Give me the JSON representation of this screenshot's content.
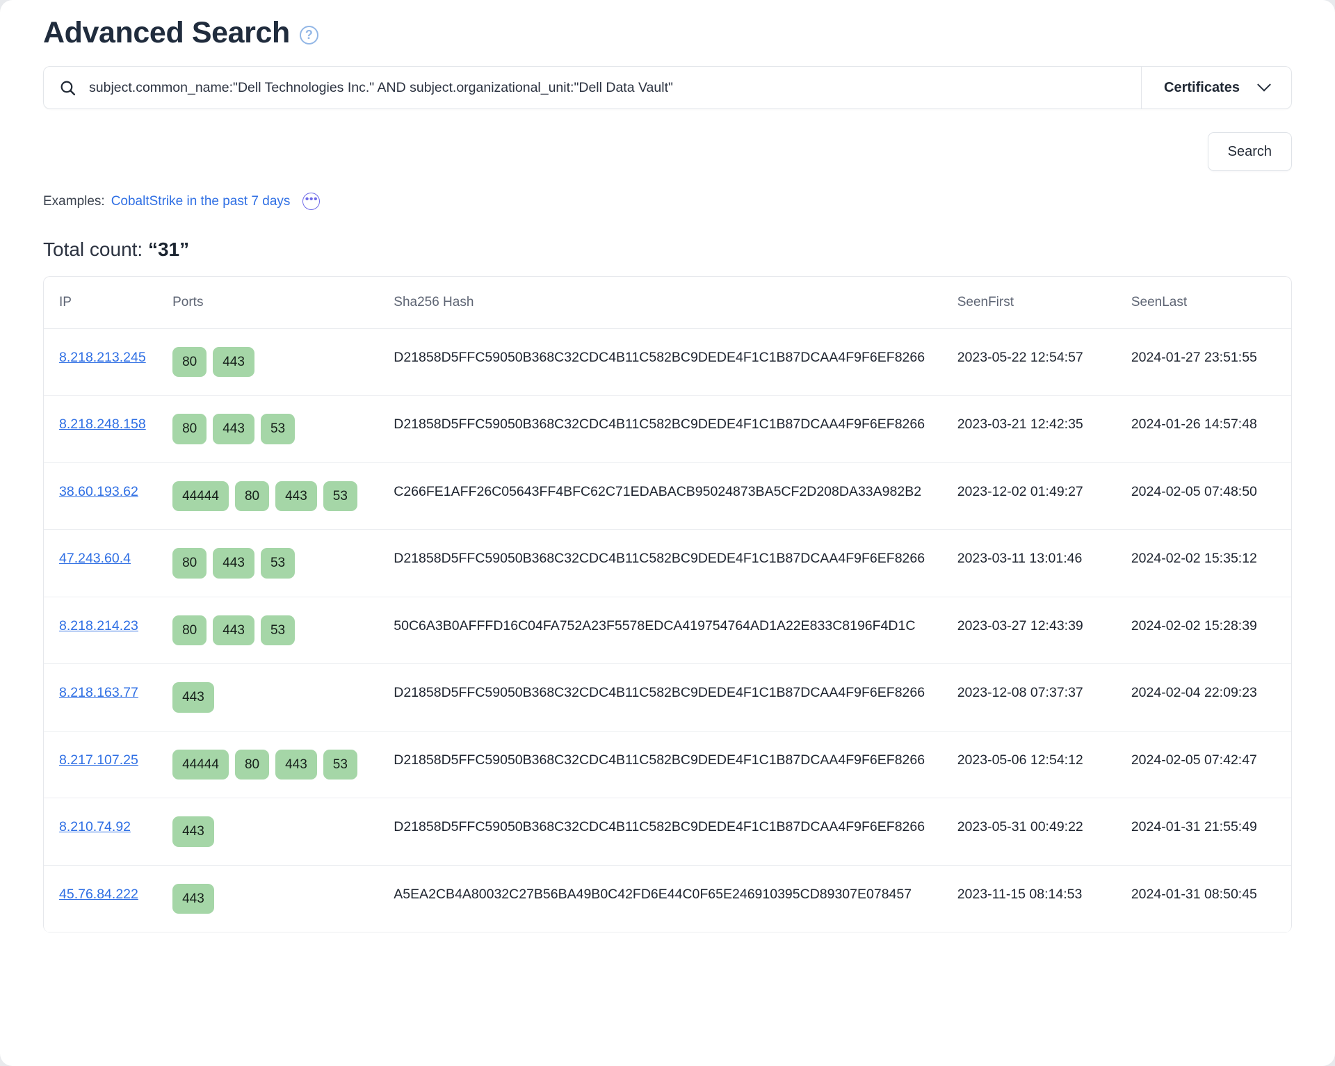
{
  "header": {
    "title": "Advanced Search",
    "help_icon": "question-mark-circle-icon"
  },
  "search": {
    "query": "subject.common_name:\"Dell Technologies Inc.\" AND subject.organizational_unit:\"Dell Data Vault\"",
    "placeholder": "Search",
    "icon": "search-icon",
    "type_selector": {
      "selected": "Certificates",
      "icon": "chevron-down-icon"
    },
    "submit_label": "Search"
  },
  "examples": {
    "label": "Examples:",
    "link_text": "CobaltStrike in the past 7 days",
    "more_icon": "ellipsis-circle-icon",
    "more_glyph": "•••"
  },
  "results": {
    "total_count_label": "Total count:",
    "total_count_value": "“31”",
    "columns": [
      "IP",
      "Ports",
      "Sha256 Hash",
      "SeenFirst",
      "SeenLast"
    ],
    "rows": [
      {
        "ip": "8.218.213.245",
        "ports": [
          "80",
          "443"
        ],
        "hash": "D21858D5FFC59050B368C32CDC4B11C582BC9DEDE4F1C1B87DCAA4F9F6EF8266",
        "seen_first": "2023-05-22 12:54:57",
        "seen_last": "2024-01-27 23:51:55"
      },
      {
        "ip": "8.218.248.158",
        "ports": [
          "80",
          "443",
          "53"
        ],
        "hash": "D21858D5FFC59050B368C32CDC4B11C582BC9DEDE4F1C1B87DCAA4F9F6EF8266",
        "seen_first": "2023-03-21 12:42:35",
        "seen_last": "2024-01-26 14:57:48"
      },
      {
        "ip": "38.60.193.62",
        "ports": [
          "44444",
          "80",
          "443",
          "53"
        ],
        "hash": "C266FE1AFF26C05643FF4BFC62C71EDABACB95024873BA5CF2D208DA33A982B2",
        "seen_first": "2023-12-02 01:49:27",
        "seen_last": "2024-02-05 07:48:50"
      },
      {
        "ip": "47.243.60.4",
        "ports": [
          "80",
          "443",
          "53"
        ],
        "hash": "D21858D5FFC59050B368C32CDC4B11C582BC9DEDE4F1C1B87DCAA4F9F6EF8266",
        "seen_first": "2023-03-11 13:01:46",
        "seen_last": "2024-02-02 15:35:12"
      },
      {
        "ip": "8.218.214.23",
        "ports": [
          "80",
          "443",
          "53"
        ],
        "hash": "50C6A3B0AFFFD16C04FA752A23F5578EDCA419754764AD1A22E833C8196F4D1C",
        "seen_first": "2023-03-27 12:43:39",
        "seen_last": "2024-02-02 15:28:39"
      },
      {
        "ip": "8.218.163.77",
        "ports": [
          "443"
        ],
        "hash": "D21858D5FFC59050B368C32CDC4B11C582BC9DEDE4F1C1B87DCAA4F9F6EF8266",
        "seen_first": "2023-12-08 07:37:37",
        "seen_last": "2024-02-04 22:09:23"
      },
      {
        "ip": "8.217.107.25",
        "ports": [
          "44444",
          "80",
          "443",
          "53"
        ],
        "hash": "D21858D5FFC59050B368C32CDC4B11C582BC9DEDE4F1C1B87DCAA4F9F6EF8266",
        "seen_first": "2023-05-06 12:54:12",
        "seen_last": "2024-02-05 07:42:47"
      },
      {
        "ip": "8.210.74.92",
        "ports": [
          "443"
        ],
        "hash": "D21858D5FFC59050B368C32CDC4B11C582BC9DEDE4F1C1B87DCAA4F9F6EF8266",
        "seen_first": "2023-05-31 00:49:22",
        "seen_last": "2024-01-31 21:55:49"
      },
      {
        "ip": "45.76.84.222",
        "ports": [
          "443"
        ],
        "hash": "A5EA2CB4A80032C27B56BA49B0C42FD6E44C0F65E246910395CD89307E078457",
        "seen_first": "2023-11-15 08:14:53",
        "seen_last": "2024-01-31 08:50:45"
      }
    ]
  },
  "colors": {
    "link": "#2f6fe4",
    "port_badge_bg": "#a5d6a7",
    "title": "#202c3d",
    "accent_more": "#6e6ae8"
  }
}
